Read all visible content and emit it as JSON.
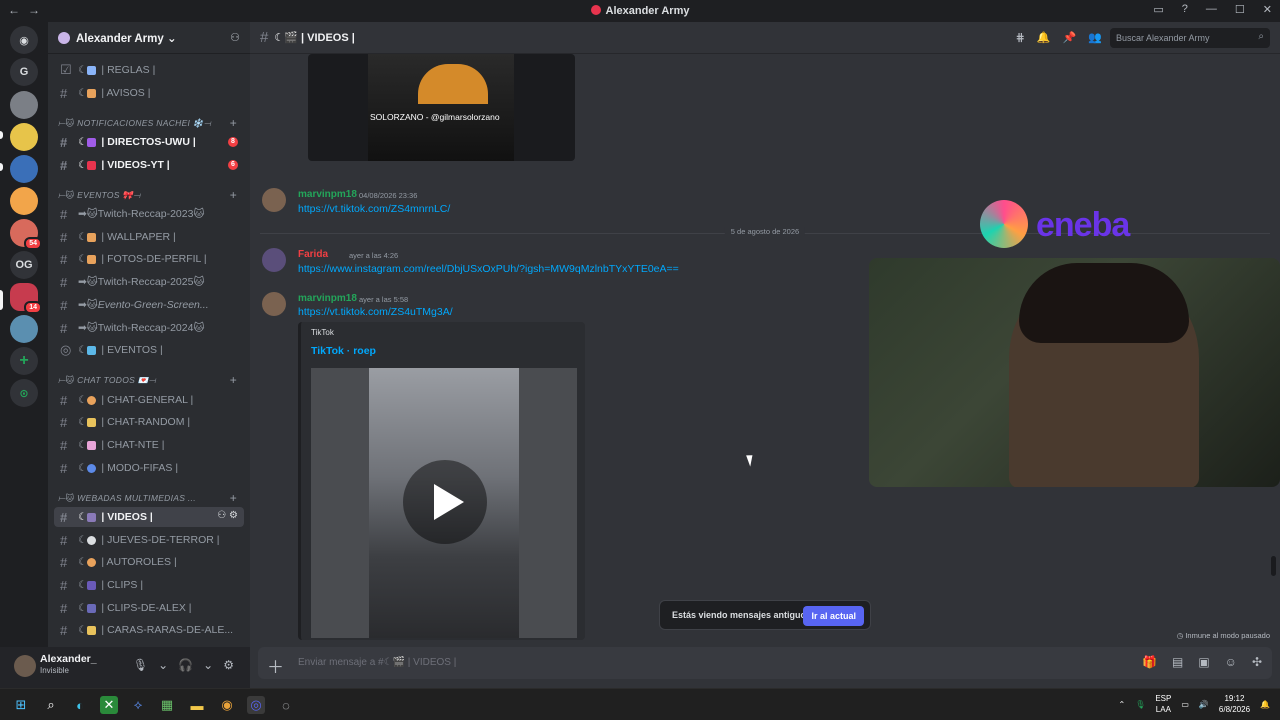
{
  "window": {
    "title": "Alexander Army",
    "back": "←",
    "forward": "→",
    "minimize": "—",
    "maximize": "☐",
    "close": "✕"
  },
  "servers": {
    "items": [
      {
        "label": "G"
      },
      {
        "label": "OG"
      }
    ],
    "badges": {
      "b1": "54",
      "b2": "14"
    }
  },
  "guild": {
    "name": "Alexander Army ⌄"
  },
  "channels": {
    "reglas": "| REGLAS |",
    "avisos": "| AVISOS |",
    "cat_notif": "⟝🐱 NOTIFICACIONES NACHEI ❄️⟞",
    "directos": "| DIRECTOS-UWU |",
    "directos_badge": "8",
    "videosyt": "| VIDEOS-YT |",
    "videosyt_badge": "6",
    "cat_eventos": "⟝🐱 EVENTOS 🎀⟞",
    "twitch2023": "➡🐱Twitch-Reccap-2023🐱",
    "wallpaper": "| WALLPAPER |",
    "fotos": "| FOTOS-DE-PERFIL |",
    "twitch2025": "➡🐱Twitch-Reccap-2025🐱",
    "green": "➡🐱Evento-Green-Screen...",
    "twitch2024": "➡🐱Twitch-Reccap-2024🐱",
    "eventos": "| EVENTOS |",
    "cat_chat": "⟝🐱 CHAT TODOS 💌⟞",
    "general": "| CHAT-GENERAL |",
    "random": "| CHAT-RANDOM |",
    "nte": "| CHAT-NTE |",
    "fifas": "| MODO-FIFAS |",
    "cat_media": "⟝🐱 WEBADAS MULTIMEDIAS ...",
    "videos": "| VIDEOS |",
    "jueves": "| JUEVES-DE-TERROR |",
    "autoroles": "| AUTOROLES |",
    "clips": "| CLIPS |",
    "clipsalex": "| CLIPS-DE-ALEX |",
    "caras": "| CARAS-RARAS-DE-ALE..."
  },
  "user": {
    "name": "Alexander_",
    "status": "Invisible"
  },
  "header": {
    "channel": "| VIDEOS |",
    "search_placeholder": "Buscar Alexander Army"
  },
  "messages": [
    {
      "user": "marvinpm18",
      "time": "04/08/2026 23:36",
      "link": "https://vt.tiktok.com/ZS4mnrnLC/",
      "color": "#23a55a"
    },
    {
      "user": "Farida",
      "time": "ayer a las 4:26",
      "link": "https://www.instagram.com/reel/DbjUSxOxPUh/?igsh=MW9qMzlnbTYxYTE0eA==",
      "color": "#f23f43"
    },
    {
      "user": "marvinpm18",
      "time": "ayer a las 5:58",
      "link": "https://vt.tiktok.com/ZS4uTMg3A/",
      "color": "#23a55a"
    }
  ],
  "image_caption": "SOLORZANO - @gilmarsolorzano",
  "date_divider": "5 de agosto de 2026",
  "embed": {
    "provider": "TikTok",
    "title": "TikTok · roep"
  },
  "toast": {
    "text": "Estás viendo mensajes antiguos",
    "button": "Ir al actual"
  },
  "slowmode": "Inmune al modo pausado",
  "composer": {
    "placeholder": "Enviar mensaje a #☾🎬 | VIDEOS |"
  },
  "overlay": {
    "brand": "eneba"
  },
  "tray": {
    "lang1": "ESP",
    "lang2": "LAA",
    "time": "19:12",
    "date": "6/8/2026"
  },
  "colors": {
    "accent": "#5865f2",
    "link": "#00a8fc",
    "danger": "#f23f43"
  }
}
